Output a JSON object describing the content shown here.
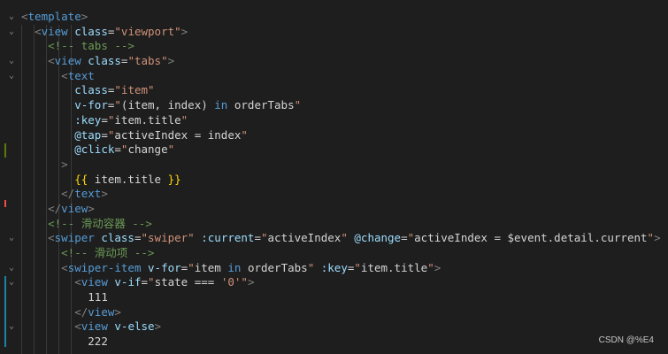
{
  "colors": {
    "background": "#1e1e1e",
    "tag": "#569cd6",
    "attr": "#9cdcfe",
    "string": "#ce9178",
    "comment": "#6a9955",
    "keyword": "#569cd6",
    "interp": "#ffd700",
    "plain": "#d4d4d4"
  },
  "code_lines": [
    {
      "indent": 0,
      "fold": "chevron-down",
      "tokens": [
        {
          "t": "punct",
          "v": "<"
        },
        {
          "t": "tag",
          "v": "template"
        },
        {
          "t": "punct",
          "v": ">"
        }
      ]
    },
    {
      "indent": 1,
      "fold": "chevron-down",
      "tokens": [
        {
          "t": "punct",
          "v": "<"
        },
        {
          "t": "tag",
          "v": "view"
        },
        {
          "t": "plain",
          "v": " "
        },
        {
          "t": "attr",
          "v": "class"
        },
        {
          "t": "plain",
          "v": "="
        },
        {
          "t": "string",
          "v": "\"viewport\""
        },
        {
          "t": "punct",
          "v": ">"
        }
      ]
    },
    {
      "indent": 2,
      "fold": "",
      "tokens": [
        {
          "t": "comment",
          "v": "<!-- tabs -->"
        }
      ]
    },
    {
      "indent": 2,
      "fold": "chevron-down",
      "tokens": [
        {
          "t": "punct",
          "v": "<"
        },
        {
          "t": "tag",
          "v": "view"
        },
        {
          "t": "plain",
          "v": " "
        },
        {
          "t": "attr",
          "v": "class"
        },
        {
          "t": "plain",
          "v": "="
        },
        {
          "t": "string",
          "v": "\"tabs\""
        },
        {
          "t": "punct",
          "v": ">"
        }
      ]
    },
    {
      "indent": 3,
      "fold": "chevron-down",
      "tokens": [
        {
          "t": "punct",
          "v": "<"
        },
        {
          "t": "tag",
          "v": "text"
        }
      ]
    },
    {
      "indent": 4,
      "fold": "",
      "tokens": [
        {
          "t": "attr",
          "v": "class"
        },
        {
          "t": "plain",
          "v": "="
        },
        {
          "t": "string",
          "v": "\"item\""
        }
      ]
    },
    {
      "indent": 4,
      "fold": "",
      "tokens": [
        {
          "t": "attr",
          "v": "v-for"
        },
        {
          "t": "plain",
          "v": "="
        },
        {
          "t": "string",
          "v": "\""
        },
        {
          "t": "plain",
          "v": "(item, index) "
        },
        {
          "t": "keyword",
          "v": "in"
        },
        {
          "t": "plain",
          "v": " orderTabs"
        },
        {
          "t": "string",
          "v": "\""
        }
      ]
    },
    {
      "indent": 4,
      "fold": "",
      "tokens": [
        {
          "t": "attr",
          "v": ":key"
        },
        {
          "t": "plain",
          "v": "="
        },
        {
          "t": "string",
          "v": "\""
        },
        {
          "t": "plain",
          "v": "item.title"
        },
        {
          "t": "string",
          "v": "\""
        }
      ]
    },
    {
      "indent": 4,
      "fold": "",
      "tokens": [
        {
          "t": "attr",
          "v": "@tap"
        },
        {
          "t": "plain",
          "v": "="
        },
        {
          "t": "string",
          "v": "\""
        },
        {
          "t": "plain",
          "v": "activeIndex = index"
        },
        {
          "t": "string",
          "v": "\""
        }
      ]
    },
    {
      "indent": 4,
      "fold": "",
      "tokens": [
        {
          "t": "attr",
          "v": "@click"
        },
        {
          "t": "plain",
          "v": "="
        },
        {
          "t": "string",
          "v": "\""
        },
        {
          "t": "plain",
          "v": "change"
        },
        {
          "t": "string",
          "v": "\""
        }
      ]
    },
    {
      "indent": 3,
      "fold": "",
      "tokens": [
        {
          "t": "punct",
          "v": ">"
        }
      ]
    },
    {
      "indent": 4,
      "fold": "",
      "tokens": [
        {
          "t": "interp",
          "v": "{{"
        },
        {
          "t": "plain",
          "v": " item.title "
        },
        {
          "t": "interp",
          "v": "}}"
        }
      ]
    },
    {
      "indent": 3,
      "fold": "",
      "tokens": [
        {
          "t": "punct",
          "v": "</"
        },
        {
          "t": "tag",
          "v": "text"
        },
        {
          "t": "punct",
          "v": ">"
        }
      ]
    },
    {
      "indent": 2,
      "fold": "",
      "tokens": [
        {
          "t": "punct",
          "v": "</"
        },
        {
          "t": "tag",
          "v": "view"
        },
        {
          "t": "punct",
          "v": ">"
        }
      ]
    },
    {
      "indent": 2,
      "fold": "",
      "tokens": [
        {
          "t": "comment",
          "v": "<!-- 滑动容器 -->"
        }
      ]
    },
    {
      "indent": 2,
      "fold": "chevron-down",
      "tokens": [
        {
          "t": "punct",
          "v": "<"
        },
        {
          "t": "tag",
          "v": "swiper"
        },
        {
          "t": "plain",
          "v": " "
        },
        {
          "t": "attr",
          "v": "class"
        },
        {
          "t": "plain",
          "v": "="
        },
        {
          "t": "string",
          "v": "\"swiper\""
        },
        {
          "t": "plain",
          "v": " "
        },
        {
          "t": "attr",
          "v": ":current"
        },
        {
          "t": "plain",
          "v": "="
        },
        {
          "t": "string",
          "v": "\""
        },
        {
          "t": "plain",
          "v": "activeIndex"
        },
        {
          "t": "string",
          "v": "\""
        },
        {
          "t": "plain",
          "v": " "
        },
        {
          "t": "attr",
          "v": "@change"
        },
        {
          "t": "plain",
          "v": "="
        },
        {
          "t": "string",
          "v": "\""
        },
        {
          "t": "plain",
          "v": "activeIndex = $event.detail.current"
        },
        {
          "t": "string",
          "v": "\""
        },
        {
          "t": "punct",
          "v": ">"
        }
      ]
    },
    {
      "indent": 3,
      "fold": "",
      "tokens": [
        {
          "t": "comment",
          "v": "<!-- 滑动项 -->"
        }
      ]
    },
    {
      "indent": 3,
      "fold": "chevron-down",
      "tokens": [
        {
          "t": "punct",
          "v": "<"
        },
        {
          "t": "tag",
          "v": "swiper-item"
        },
        {
          "t": "plain",
          "v": " "
        },
        {
          "t": "attr",
          "v": "v-for"
        },
        {
          "t": "plain",
          "v": "="
        },
        {
          "t": "string",
          "v": "\""
        },
        {
          "t": "plain",
          "v": "item "
        },
        {
          "t": "keyword",
          "v": "in"
        },
        {
          "t": "plain",
          "v": " orderTabs"
        },
        {
          "t": "string",
          "v": "\""
        },
        {
          "t": "plain",
          "v": " "
        },
        {
          "t": "attr",
          "v": ":key"
        },
        {
          "t": "plain",
          "v": "="
        },
        {
          "t": "string",
          "v": "\""
        },
        {
          "t": "plain",
          "v": "item.title"
        },
        {
          "t": "string",
          "v": "\""
        },
        {
          "t": "punct",
          "v": ">"
        }
      ]
    },
    {
      "indent": 4,
      "fold": "chevron-down",
      "tokens": [
        {
          "t": "punct",
          "v": "<"
        },
        {
          "t": "tag",
          "v": "view"
        },
        {
          "t": "plain",
          "v": " "
        },
        {
          "t": "attr",
          "v": "v-if"
        },
        {
          "t": "plain",
          "v": "="
        },
        {
          "t": "string",
          "v": "\""
        },
        {
          "t": "plain",
          "v": "state === "
        },
        {
          "t": "string",
          "v": "'0'"
        },
        {
          "t": "string",
          "v": "\""
        },
        {
          "t": "punct",
          "v": ">"
        }
      ]
    },
    {
      "indent": 5,
      "fold": "",
      "tokens": [
        {
          "t": "plain",
          "v": "111"
        }
      ]
    },
    {
      "indent": 4,
      "fold": "",
      "tokens": [
        {
          "t": "punct",
          "v": "</"
        },
        {
          "t": "tag",
          "v": "view"
        },
        {
          "t": "punct",
          "v": ">"
        }
      ]
    },
    {
      "indent": 4,
      "fold": "chevron-down",
      "tokens": [
        {
          "t": "punct",
          "v": "<"
        },
        {
          "t": "tag",
          "v": "view"
        },
        {
          "t": "plain",
          "v": " "
        },
        {
          "t": "attr",
          "v": "v-else"
        },
        {
          "t": "punct",
          "v": ">"
        }
      ]
    },
    {
      "indent": 5,
      "fold": "",
      "tokens": [
        {
          "t": "plain",
          "v": "222"
        }
      ]
    }
  ],
  "watermark": "CSDN @%E4"
}
